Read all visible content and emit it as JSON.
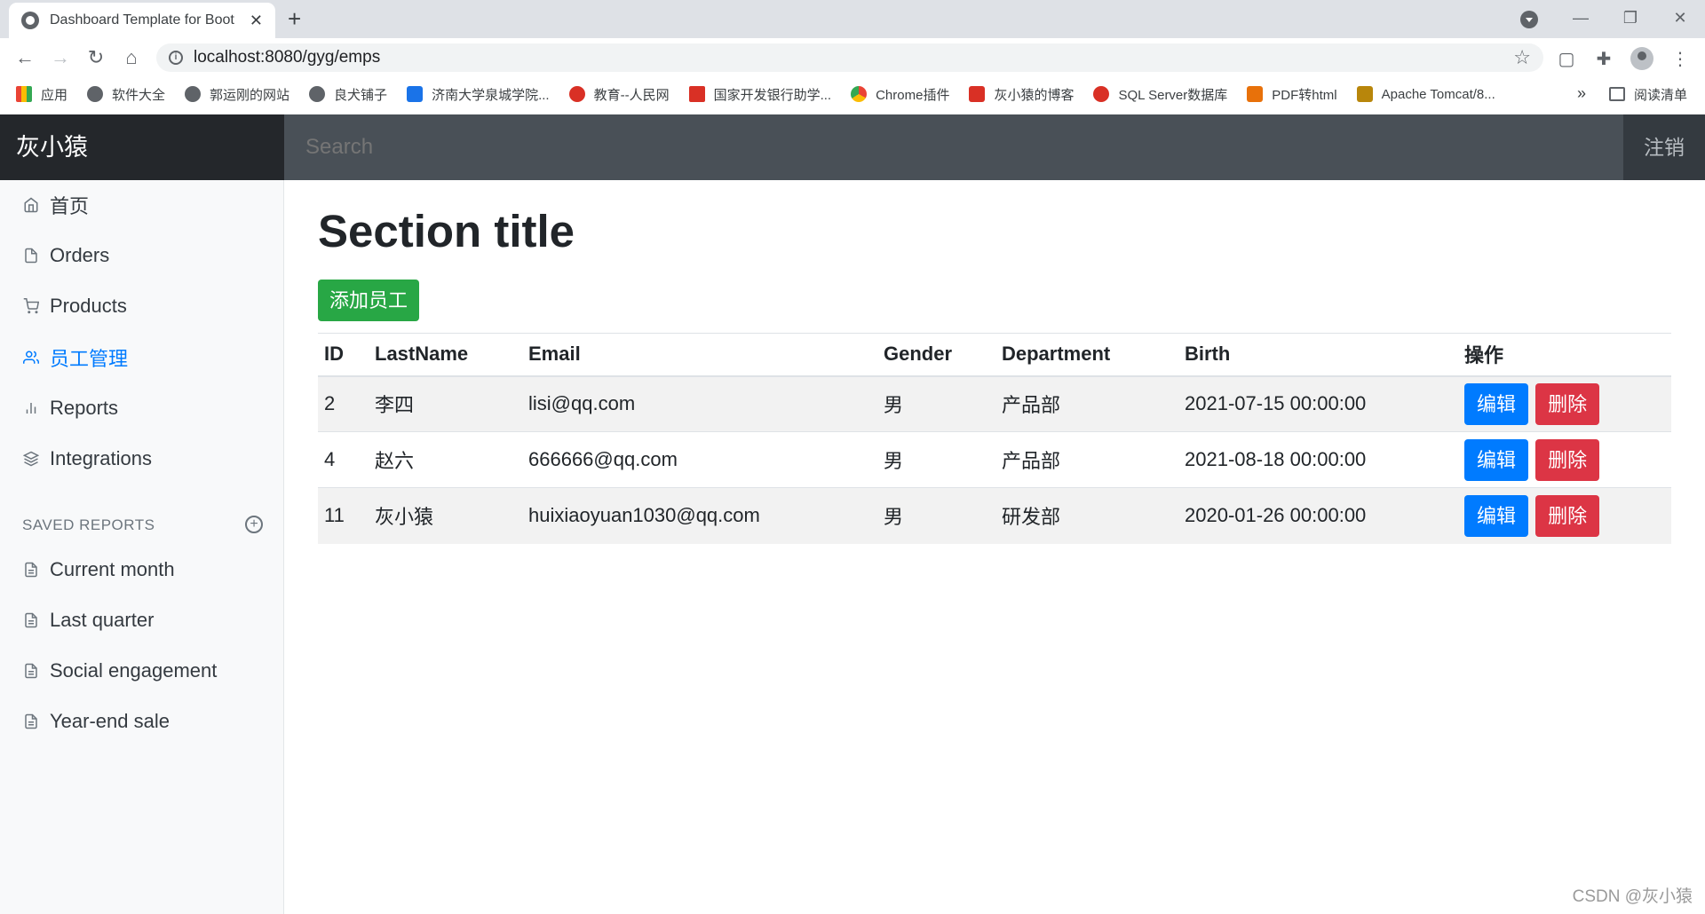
{
  "browser": {
    "tab_title": "Dashboard Template for Boot",
    "url": "localhost:8080/gyg/emps",
    "bookmarks": [
      {
        "label": "应用",
        "icon": "apps-grid-icon"
      },
      {
        "label": "软件大全",
        "icon": "globe-icon"
      },
      {
        "label": "郭运刚的网站",
        "icon": "globe-icon"
      },
      {
        "label": "良犬铺子",
        "icon": "globe-icon"
      },
      {
        "label": "济南大学泉城学院...",
        "icon": "school-icon"
      },
      {
        "label": "教育--人民网",
        "icon": "people-daily-icon"
      },
      {
        "label": "国家开发银行助学...",
        "icon": "bank-icon"
      },
      {
        "label": "Chrome插件",
        "icon": "chrome-icon"
      },
      {
        "label": "灰小猿的博客",
        "icon": "csdn-icon"
      },
      {
        "label": "SQL Server数据库",
        "icon": "sqlserver-icon"
      },
      {
        "label": "PDF转html",
        "icon": "pdf-icon"
      },
      {
        "label": "Apache Tomcat/8...",
        "icon": "tomcat-icon"
      }
    ],
    "more_bookmarks": "»",
    "reading_list": "阅读清单"
  },
  "navbar": {
    "brand": "灰小猿",
    "search_placeholder": "Search",
    "signout": "注销"
  },
  "sidebar": {
    "items": [
      {
        "label": "首页",
        "icon": "home-icon",
        "active": false
      },
      {
        "label": "Orders",
        "icon": "file-icon",
        "active": false
      },
      {
        "label": "Products",
        "icon": "shopping-cart-icon",
        "active": false
      },
      {
        "label": "员工管理",
        "icon": "users-icon",
        "active": true
      },
      {
        "label": "Reports",
        "icon": "bar-chart-icon",
        "active": false
      },
      {
        "label": "Integrations",
        "icon": "layers-icon",
        "active": false
      }
    ],
    "saved_reports_heading": "SAVED REPORTS",
    "saved_reports": [
      {
        "label": "Current month",
        "icon": "file-text-icon"
      },
      {
        "label": "Last quarter",
        "icon": "file-text-icon"
      },
      {
        "label": "Social engagement",
        "icon": "file-text-icon"
      },
      {
        "label": "Year-end sale",
        "icon": "file-text-icon"
      }
    ]
  },
  "main": {
    "title": "Section title",
    "add_button": "添加员工",
    "columns": [
      "ID",
      "LastName",
      "Email",
      "Gender",
      "Department",
      "Birth",
      "操作"
    ],
    "rows": [
      [
        "2",
        "李四",
        "lisi@qq.com",
        "男",
        "产品部",
        "2021-07-15 00:00:00"
      ],
      [
        "4",
        "赵六",
        "666666@qq.com",
        "男",
        "产品部",
        "2021-08-18 00:00:00"
      ],
      [
        "11",
        "灰小猿",
        "huixiaoyuan1030@qq.com",
        "男",
        "研发部",
        "2020-01-26 00:00:00"
      ]
    ],
    "edit_label": "编辑",
    "delete_label": "删除"
  },
  "watermark": "CSDN @灰小猿",
  "colors": {
    "brand_bg": "#24272b",
    "navbar_bg": "#343a40",
    "active_link": "#007bff",
    "add_button": "#28a745",
    "edit_button": "#007bff",
    "delete_button": "#dc3545"
  }
}
